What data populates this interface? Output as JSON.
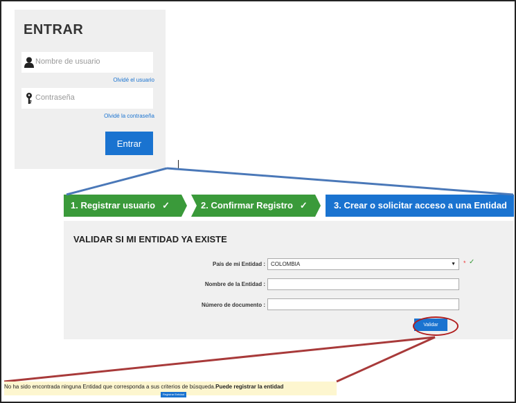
{
  "login": {
    "title": "ENTRAR",
    "username_placeholder": "Nombre de usuario",
    "forgot_user": "Olvidé el usuario",
    "password_placeholder": "Contraseña",
    "forgot_password": "Olvidé la contraseña",
    "submit_label": "Entrar"
  },
  "steps": [
    {
      "label": "1. Registrar usuario",
      "done": true
    },
    {
      "label": "2. Confirmar Registro",
      "done": true
    },
    {
      "label": "3. Crear o solicitar acceso a una Entidad",
      "done": false
    }
  ],
  "step_check": "✓",
  "form": {
    "title": "VALIDAR SI MI ENTIDAD YA EXISTE",
    "country_label": "País de mi Entidad :",
    "country_value": "COLOMBIA",
    "entity_name_label": "Nombre de la Entidad :",
    "entity_name_value": "",
    "doc_number_label": "Número de documento :",
    "doc_number_value": "",
    "required_mark": "*",
    "valid_mark": "✓",
    "validate_label": "Validar"
  },
  "notice": {
    "message": "No ha sido encontrada ninguna Entidad que corresponda a sus criterios de búsqueda.",
    "emphasis": "Puede registrar la entidad",
    "register_label": "Registrar Entidad"
  },
  "colors": {
    "primary": "#1a73d0",
    "step_done": "#3a9a3a",
    "highlight_ring": "#b01c1c",
    "zoom_line": "#4a78b8",
    "callout_line": "#a83a3a",
    "notice_bg": "#fdf6cf"
  }
}
